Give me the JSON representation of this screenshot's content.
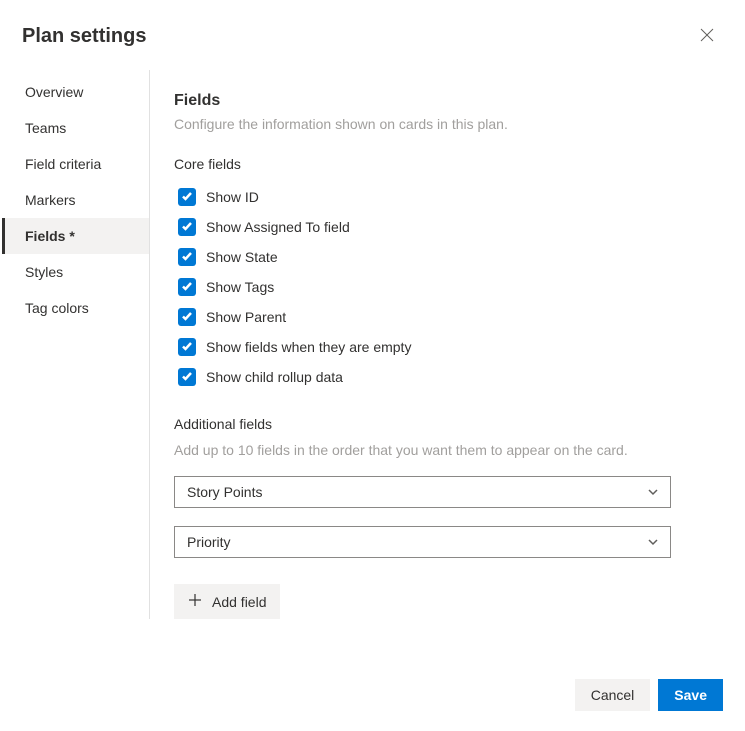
{
  "header": {
    "title": "Plan settings"
  },
  "sidebar": {
    "items": [
      {
        "label": "Overview",
        "active": false
      },
      {
        "label": "Teams",
        "active": false
      },
      {
        "label": "Field criteria",
        "active": false
      },
      {
        "label": "Markers",
        "active": false
      },
      {
        "label": "Fields *",
        "active": true
      },
      {
        "label": "Styles",
        "active": false
      },
      {
        "label": "Tag colors",
        "active": false
      }
    ]
  },
  "main": {
    "title": "Fields",
    "subtitle": "Configure the information shown on cards in this plan.",
    "coreFieldsLabel": "Core fields",
    "coreFields": [
      {
        "label": "Show ID",
        "checked": true
      },
      {
        "label": "Show Assigned To field",
        "checked": true
      },
      {
        "label": "Show State",
        "checked": true
      },
      {
        "label": "Show Tags",
        "checked": true
      },
      {
        "label": "Show Parent",
        "checked": true
      },
      {
        "label": "Show fields when they are empty",
        "checked": true
      },
      {
        "label": "Show child rollup data",
        "checked": true
      }
    ],
    "additionalFieldsLabel": "Additional fields",
    "additionalFieldsSubtitle": "Add up to 10 fields in the order that you want them to appear on the card.",
    "additionalFields": [
      {
        "label": "Story Points"
      },
      {
        "label": "Priority"
      }
    ],
    "addFieldButton": "Add field"
  },
  "footer": {
    "cancel": "Cancel",
    "save": "Save"
  }
}
